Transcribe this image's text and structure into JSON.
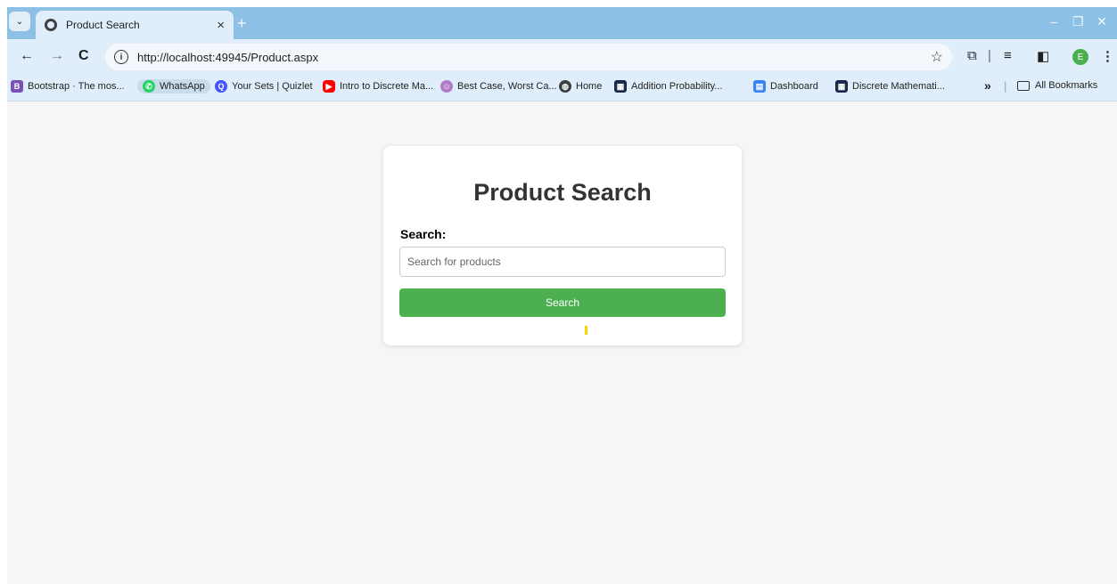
{
  "browser": {
    "tab_title": "Product Search",
    "tab_close": "×",
    "new_tab": "+",
    "url": "http://localhost:49945/Product.aspx",
    "profile_initial": "E",
    "window_controls": {
      "minimize": "–",
      "restore": "❐",
      "close": "✕"
    }
  },
  "bookmarks": [
    {
      "label": "Bootstrap · The mos...",
      "icon": "bootstrap-icon",
      "color": "#7952b3",
      "glyph": "B"
    },
    {
      "label": "WhatsApp",
      "icon": "whatsapp-icon",
      "color": "#25d366",
      "glyph": "✆"
    },
    {
      "label": "Your Sets | Quizlet",
      "icon": "quizlet-icon",
      "color": "#4255ff",
      "glyph": "Q"
    },
    {
      "label": "Intro to Discrete Ma...",
      "icon": "youtube-icon",
      "color": "#ff0000",
      "glyph": "▶"
    },
    {
      "label": "Best Case, Worst Ca...",
      "icon": "avatar-icon",
      "color": "#b07cc6",
      "glyph": "☺"
    },
    {
      "label": "Home",
      "icon": "globe-icon",
      "color": "#3c4043",
      "glyph": "◍"
    },
    {
      "label": "Addition Probability...",
      "icon": "calculator-icon",
      "color": "#1b2a4a",
      "glyph": "▦"
    },
    {
      "label": "Dashboard",
      "icon": "dashboard-icon",
      "color": "#3b82f6",
      "glyph": "▤"
    },
    {
      "label": "Discrete Mathemati...",
      "icon": "calculator-icon",
      "color": "#1b2a4a",
      "glyph": "▦"
    }
  ],
  "bookmarks_overflow": "»",
  "all_bookmarks": "All Bookmarks",
  "page": {
    "heading": "Product Search",
    "search_label": "Search:",
    "search_placeholder": "Search for products",
    "search_value": "",
    "search_button": "Search"
  },
  "colors": {
    "button": "#4caf50",
    "page_bg": "#f6f6f6",
    "tabstrip": "#8cc0e4",
    "toolbar": "#dfeefa"
  }
}
